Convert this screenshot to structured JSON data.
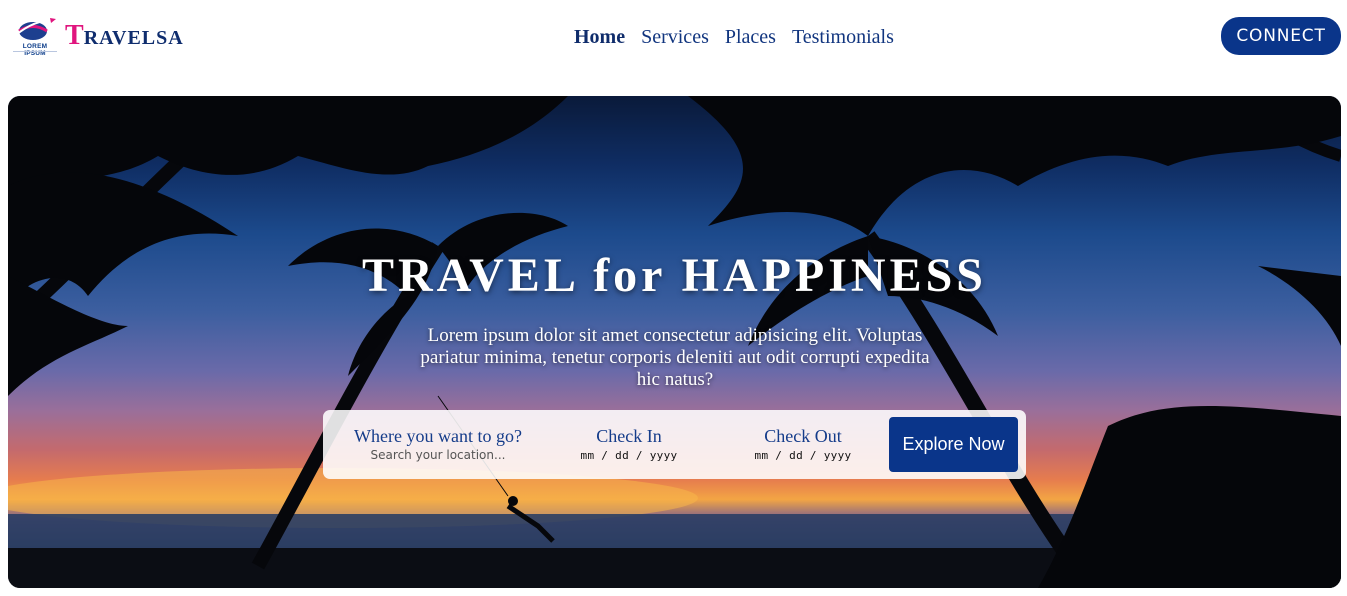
{
  "header": {
    "logo_caption": "LOREM IPSUM",
    "brand_initial": "T",
    "brand_rest": "RAVELSA",
    "nav": [
      {
        "label": "Home",
        "active": true
      },
      {
        "label": "Services",
        "active": false
      },
      {
        "label": "Places",
        "active": false
      },
      {
        "label": "Testimonials",
        "active": false
      }
    ],
    "connect_label": "CONNECT"
  },
  "hero": {
    "title": "TRAVEL for HAPPINESS",
    "description": "Lorem ipsum dolor sit amet consectetur adipisicing elit. Voluptas pariatur minima, tenetur corporis deleniti aut odit corrupti expedita hic natus?",
    "search": {
      "destination_label": "Where you want to go?",
      "destination_placeholder": "Search your location...",
      "checkin_label": "Check In",
      "checkin_value": "mm / dd / yyyy",
      "checkout_label": "Check Out",
      "checkout_value": "mm / dd / yyyy",
      "explore_label": "Explore Now"
    }
  },
  "colors": {
    "primary": "#0a358a",
    "brand_accent": "#e0157e",
    "nav_text": "#11357f"
  },
  "icons": [
    "logo-globe-icon",
    "plane-swoosh-icon"
  ]
}
